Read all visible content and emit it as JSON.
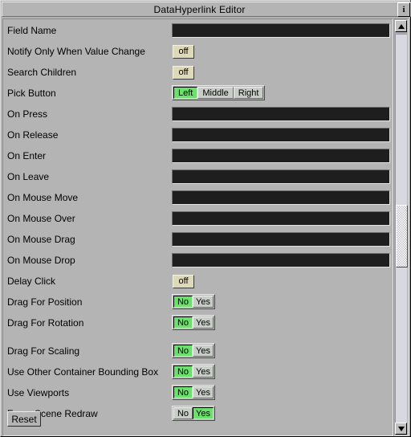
{
  "window": {
    "title": "DataHyperlink Editor",
    "info_button_label": "i",
    "background_color": "#b4b4b4"
  },
  "colors": {
    "accent_selected": "#6ce06c",
    "toggle_off": "#ded9b9",
    "entry_background": "#1e1e1e",
    "unselected_button": "#c8cdc8"
  },
  "fields": [
    {
      "label": "Field Name",
      "type": "entry",
      "value": ""
    },
    {
      "label": "Notify Only When Value Change",
      "type": "toggle",
      "value": "off"
    },
    {
      "label": "Search Children",
      "type": "toggle",
      "value": "off"
    },
    {
      "label": "Pick Button",
      "type": "radio",
      "options": [
        "Left",
        "Middle",
        "Right"
      ],
      "selected": "Left"
    },
    {
      "label": "On Press",
      "type": "entry",
      "value": ""
    },
    {
      "label": "On Release",
      "type": "entry",
      "value": ""
    },
    {
      "label": "On Enter",
      "type": "entry",
      "value": ""
    },
    {
      "label": "On Leave",
      "type": "entry",
      "value": ""
    },
    {
      "label": "On Mouse Move",
      "type": "entry",
      "value": ""
    },
    {
      "label": "On Mouse Over",
      "type": "entry",
      "value": ""
    },
    {
      "label": "On Mouse Drag",
      "type": "entry",
      "value": ""
    },
    {
      "label": "On Mouse Drop",
      "type": "entry",
      "value": ""
    },
    {
      "label": "Delay Click",
      "type": "toggle",
      "value": "off"
    },
    {
      "label": "Drag For Position",
      "type": "radio",
      "options": [
        "No",
        "Yes"
      ],
      "selected": "No"
    },
    {
      "label": "Drag For Rotation",
      "type": "radio",
      "options": [
        "No",
        "Yes"
      ],
      "selected": "No"
    },
    {
      "label": "Drag For Scaling",
      "type": "radio",
      "options": [
        "No",
        "Yes"
      ],
      "selected": "No"
    },
    {
      "label": "Use Other Container Bounding Box",
      "type": "radio",
      "options": [
        "No",
        "Yes"
      ],
      "selected": "No"
    },
    {
      "label": "Use Viewports",
      "type": "radio",
      "options": [
        "No",
        "Yes"
      ],
      "selected": "No"
    },
    {
      "label": "Force Scene Redraw",
      "type": "radio",
      "options": [
        "No",
        "Yes"
      ],
      "selected": "Yes"
    }
  ],
  "buttons": {
    "reset_label": "Reset"
  },
  "scrollbar": {
    "up_arrow": "scroll-up-icon",
    "down_arrow": "scroll-down-icon",
    "thumb_position_percent": 44
  }
}
